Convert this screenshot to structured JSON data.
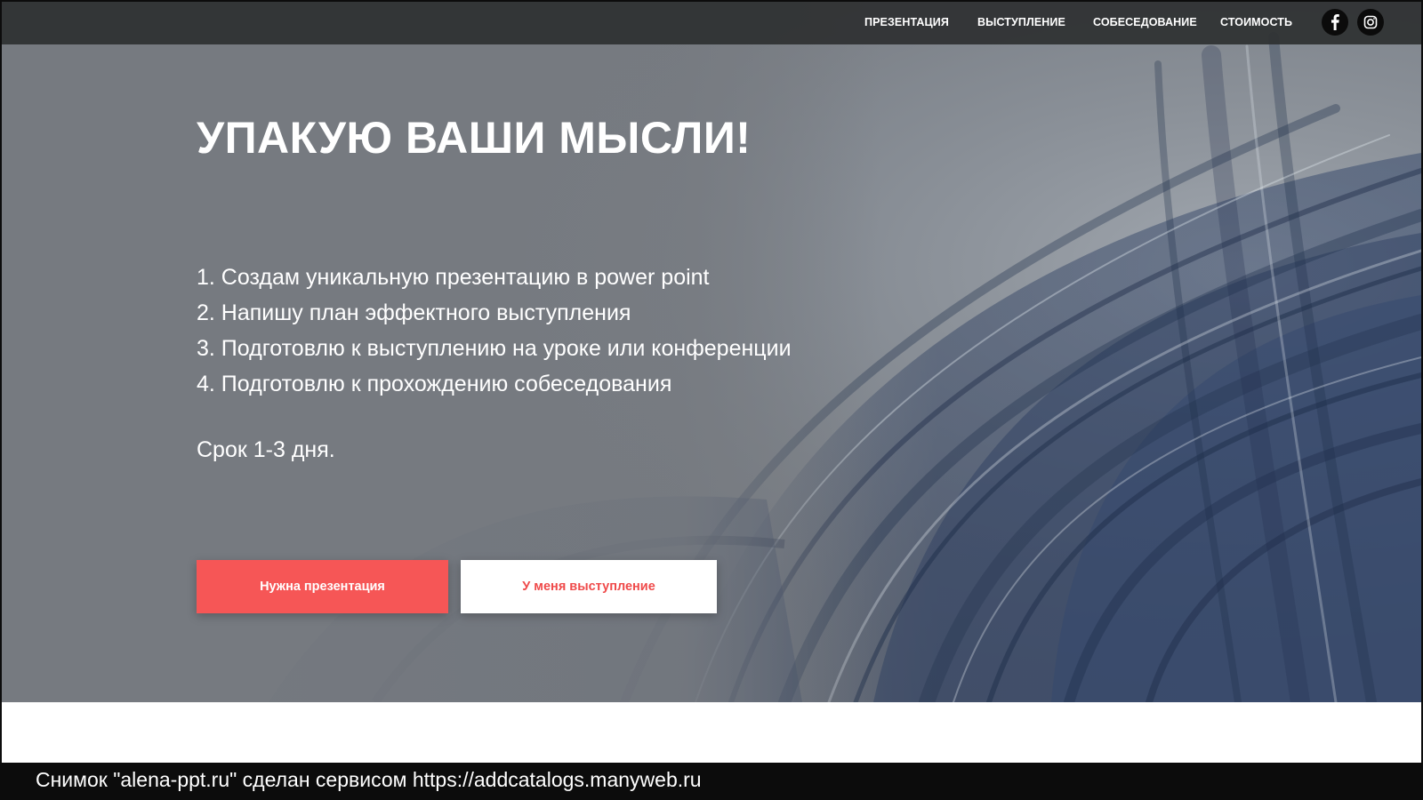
{
  "nav": {
    "items": [
      {
        "label": "ПРЕЗЕНТАЦИЯ"
      },
      {
        "label": "ВЫСТУПЛЕНИЕ"
      },
      {
        "label": "СОБЕСЕДОВАНИЕ"
      },
      {
        "label": "СТОИМОСТЬ"
      }
    ],
    "social": [
      {
        "icon": "facebook-icon"
      },
      {
        "icon": "instagram-icon"
      }
    ]
  },
  "hero": {
    "title": "УПАКУЮ ВАШИ МЫСЛИ!",
    "services": [
      "1. Создам уникальную презентацию в power point",
      "2. Напишу план эффектного выступления",
      "3. Подготовлю к выступлению на уроке или конференции",
      "4. Подготовлю к прохождению собеседования"
    ],
    "term": "Срок 1-3 дня.",
    "buttons": {
      "primary": "Нужна презентация",
      "secondary": "У меня выступление"
    }
  },
  "caption": "Снимок \"alena-ppt.ru\" сделан сервисом https://addcatalogs.manyweb.ru",
  "colors": {
    "navbar": "#2e3032",
    "hero_background": "#767a80",
    "accent_red": "#f65656",
    "button_secondary_text": "#ef4a4a",
    "swirl_blue": "#2c3e5f"
  }
}
